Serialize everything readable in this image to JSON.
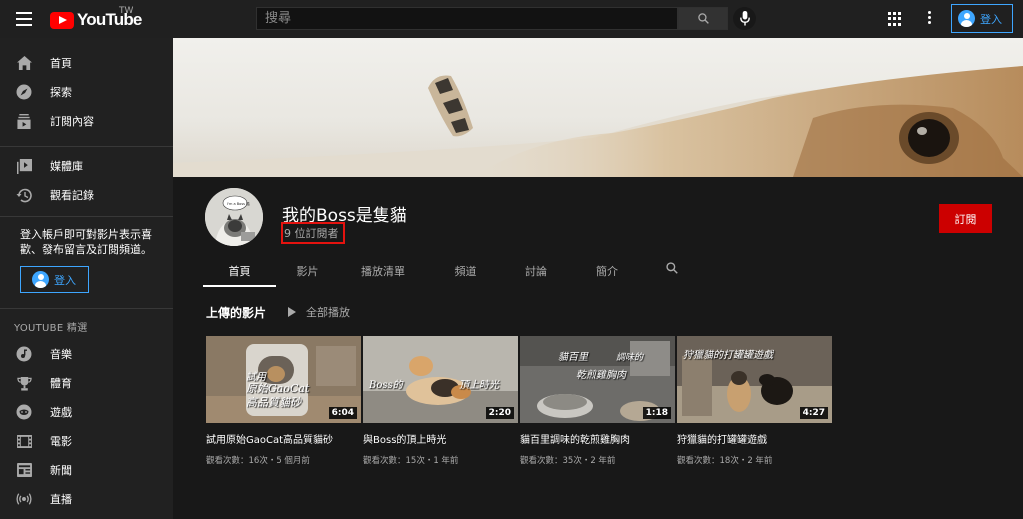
{
  "header": {
    "logo_text": "YouTube",
    "region": "TW",
    "search_placeholder": "搜尋",
    "signin_label": "登入"
  },
  "sidebar": {
    "primary": [
      {
        "label": "首頁",
        "icon": "home-icon"
      },
      {
        "label": "探索",
        "icon": "explore-icon"
      },
      {
        "label": "訂閱內容",
        "icon": "subscriptions-icon"
      }
    ],
    "secondary": [
      {
        "label": "媒體庫",
        "icon": "library-icon"
      },
      {
        "label": "觀看記錄",
        "icon": "history-icon"
      }
    ],
    "signin_message": "登入帳戶即可對影片表示喜歡、發布留言及訂閱頻道。",
    "signin_label": "登入",
    "section_title": "YOUTUBE 精選",
    "best_of": [
      {
        "label": "音樂",
        "icon": "music-icon"
      },
      {
        "label": "體育",
        "icon": "trophy-icon"
      },
      {
        "label": "遊戲",
        "icon": "gaming-icon"
      },
      {
        "label": "電影",
        "icon": "movie-icon"
      },
      {
        "label": "新聞",
        "icon": "news-icon"
      },
      {
        "label": "直播",
        "icon": "live-icon"
      }
    ]
  },
  "channel": {
    "name": "我的Boss是隻貓",
    "subscribers": "9 位訂閱者",
    "subscribe_label": "訂閱",
    "avatar_text": "I'm a Boss 喵",
    "tabs": [
      "首頁",
      "影片",
      "播放清單",
      "頻道",
      "討論",
      "簡介"
    ],
    "active_tab": "首頁"
  },
  "uploads": {
    "title": "上傳的影片",
    "play_all": "全部播放",
    "videos": [
      {
        "title": "試用原始GaoCat高品質貓砂",
        "meta": "觀看次數：16次・5 個月前",
        "duration": "6:04",
        "caption_1": "試用",
        "caption_2": "原始GaoCat",
        "caption_3": "高品質貓砂",
        "colors": [
          "#8a7a66",
          "#d9d3c8"
        ]
      },
      {
        "title": "與Boss的頂上時光",
        "meta": "觀看次數：15次・1 年前",
        "duration": "2:20",
        "caption_1": "Boss的",
        "caption_2": "頂上時光",
        "caption_3": "",
        "colors": [
          "#8e8a82",
          "#c2bfb8"
        ]
      },
      {
        "title": "貓百里調味的乾煎雞胸肉",
        "meta": "觀看次數：35次・2 年前",
        "duration": "1:18",
        "caption_1": "貓百里",
        "caption_2": "調味的",
        "caption_3": "乾煎雞胸肉",
        "colors": [
          "#6d6d6b",
          "#9a9894"
        ]
      },
      {
        "title": "狩獵貓的打罐罐遊戲",
        "meta": "觀看次數：18次・2 年前",
        "duration": "4:27",
        "caption_1": "狩獵貓的打罐罐遊戲",
        "caption_2": "",
        "caption_3": "",
        "colors": [
          "#5a524a",
          "#a69a88"
        ]
      }
    ]
  }
}
